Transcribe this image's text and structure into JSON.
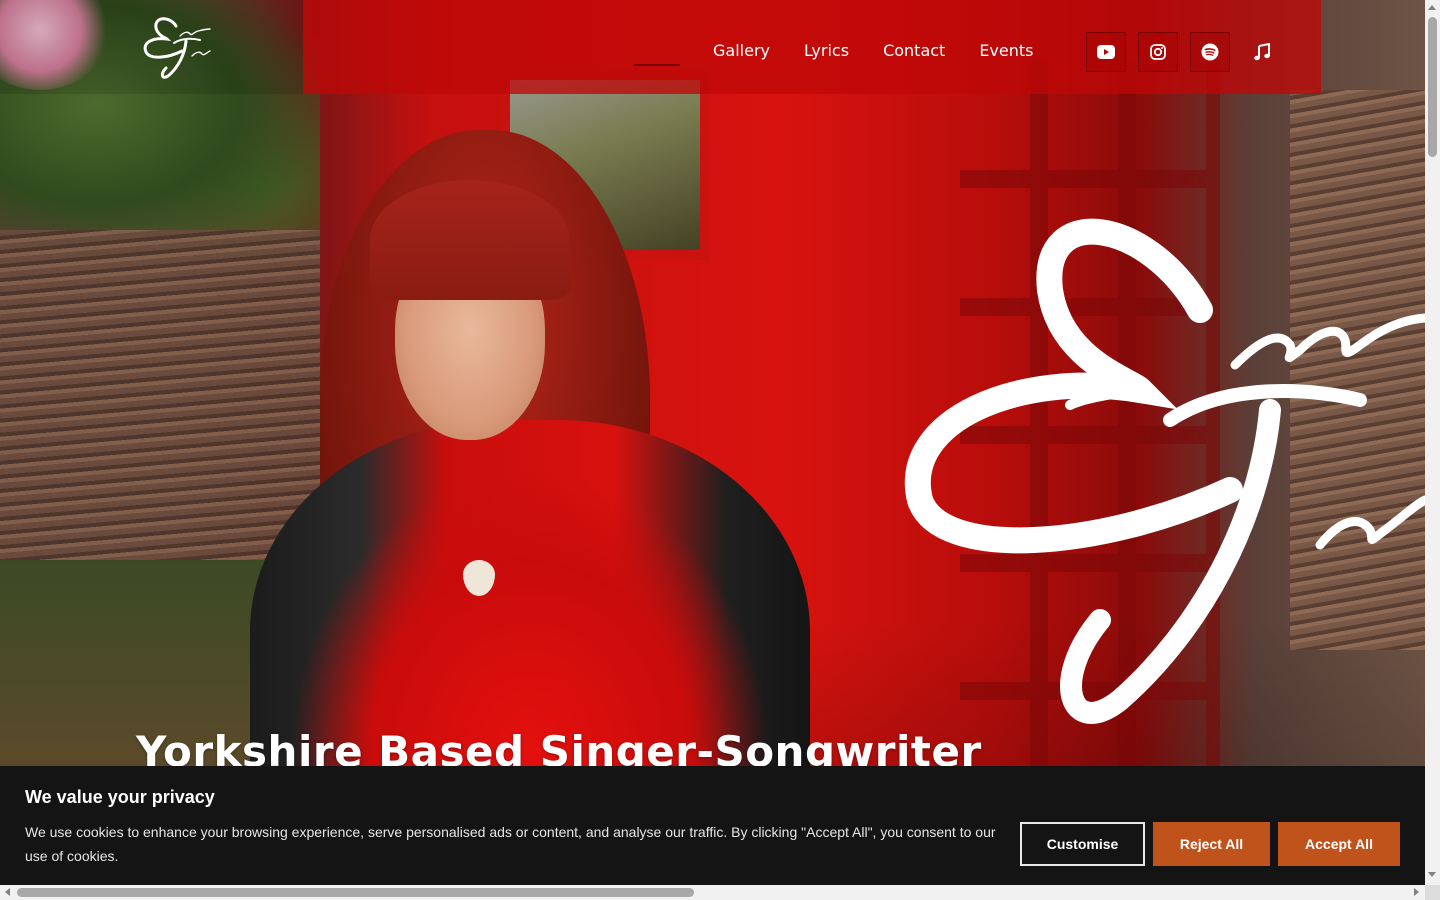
{
  "header": {
    "logo_alt": "Emma Jane",
    "nav": [
      "Gallery",
      "Lyrics",
      "Contact",
      "Events"
    ],
    "social": [
      {
        "icon": "youtube-icon"
      },
      {
        "icon": "instagram-icon"
      },
      {
        "icon": "spotify-icon"
      },
      {
        "icon": "music-note-icon"
      }
    ]
  },
  "hero": {
    "headline": "Yorkshire Based Singer-Songwriter",
    "monogram_text": "Emma Jane"
  },
  "cookie": {
    "title": "We value your privacy",
    "text": "We use cookies to enhance your browsing experience, serve personalised ads or content, and analyse our traffic. By clicking \"Accept All\", you consent to our use of cookies.",
    "customise_label": "Customise",
    "reject_label": "Reject All",
    "accept_label": "Accept All"
  },
  "colors": {
    "brand_red": "#be0808",
    "button_orange": "#c0531c",
    "banner_bg": "#141414"
  }
}
